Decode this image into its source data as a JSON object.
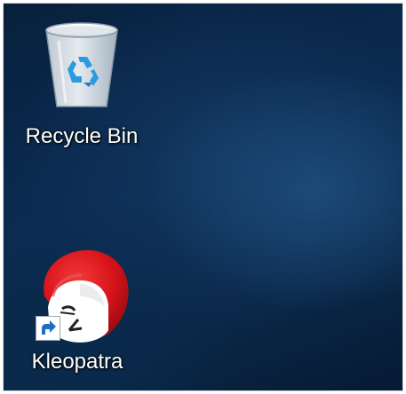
{
  "desktop": {
    "icons": [
      {
        "label": "Recycle Bin",
        "icon": "recycle-bin-icon"
      },
      {
        "label": "Kleopatra",
        "icon": "kleopatra-icon",
        "shortcut": true
      }
    ]
  },
  "colors": {
    "wallpaper_dark": "#07203d",
    "wallpaper_light": "#1c4a78",
    "recycle_symbol": "#2b9be0",
    "kleopatra_red": "#d8131b",
    "label_text": "#ffffff"
  }
}
